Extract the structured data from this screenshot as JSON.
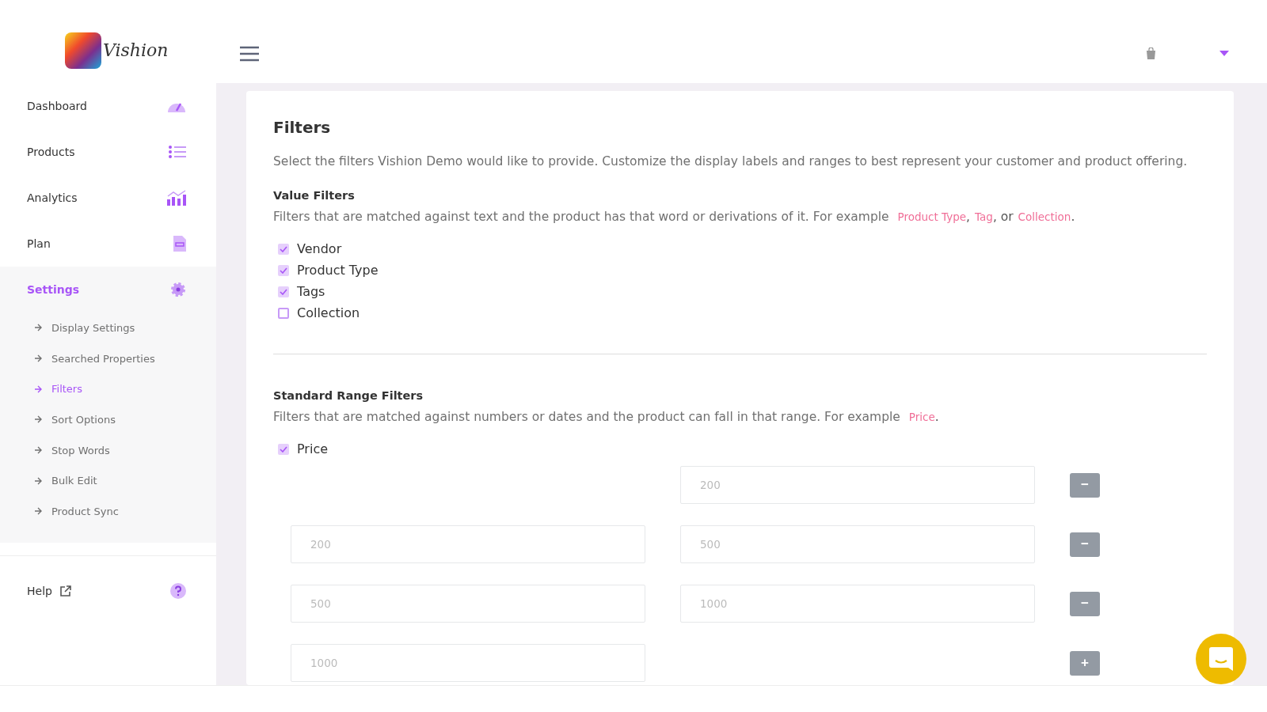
{
  "logo": {
    "text": "Vishion"
  },
  "sidebar": {
    "items": [
      {
        "label": "Dashboard",
        "selected": false
      },
      {
        "label": "Products",
        "selected": false
      },
      {
        "label": "Analytics",
        "selected": false
      },
      {
        "label": "Plan",
        "selected": false
      },
      {
        "label": "Settings",
        "selected": true,
        "children": [
          {
            "label": "Display Settings",
            "selected": false
          },
          {
            "label": "Searched Properties",
            "selected": false
          },
          {
            "label": "Filters",
            "selected": true
          },
          {
            "label": "Sort Options",
            "selected": false
          },
          {
            "label": "Stop Words",
            "selected": false
          },
          {
            "label": "Bulk Edit",
            "selected": false
          },
          {
            "label": "Product Sync",
            "selected": false
          }
        ]
      }
    ],
    "help": {
      "label": "Help"
    }
  },
  "page": {
    "title": "Filters",
    "description": "Select the filters Vishion Demo would like to provide. Customize the display labels and ranges to best represent your customer and product offering.",
    "value_filters": {
      "heading": "Value Filters",
      "intro": "Filters that are matched against text and the product has that word or derivations of it. For example",
      "examples": [
        "Product Type",
        "Tag",
        "Collection"
      ],
      "separators": [
        ",",
        ", or",
        "."
      ],
      "options": [
        {
          "label": "Vendor",
          "checked": true
        },
        {
          "label": "Product Type",
          "checked": true
        },
        {
          "label": "Tags",
          "checked": true
        },
        {
          "label": "Collection",
          "checked": false
        }
      ]
    },
    "range_filters": {
      "heading": "Standard Range Filters",
      "intro": "Filters that are matched against numbers or dates and the product can fall in that range. For example",
      "examples": [
        "Price"
      ],
      "separators": [
        "."
      ],
      "options": [
        {
          "label": "Price",
          "checked": true
        }
      ],
      "ranges": [
        {
          "to_value": "200",
          "button": "−"
        },
        {
          "from_value": "200",
          "to_value": "500",
          "button": "−"
        },
        {
          "from_value": "500",
          "to_value": "1000",
          "button": "−"
        },
        {
          "from_value": "1000",
          "button": "+"
        }
      ]
    }
  }
}
